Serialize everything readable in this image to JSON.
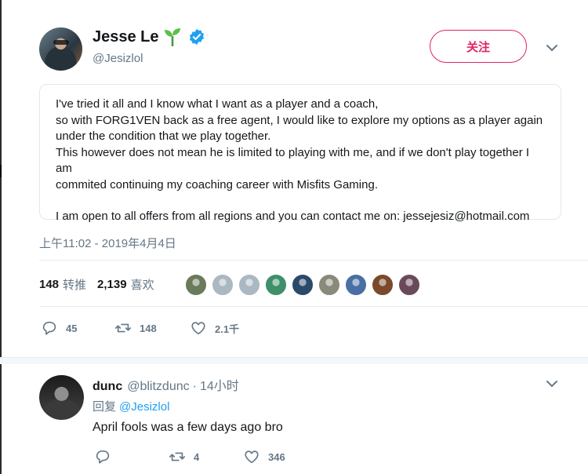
{
  "tweet": {
    "author_name": "Jesse Le",
    "author_handle": "@Jesizlol",
    "follow_label": "关注",
    "body_lines": [
      "I've tried it all and I know what I want as a player and a coach,",
      "so with FORG1VEN back as a free agent, I would like to explore my options as a player again",
      "under the condition that we play together.",
      "This however does not mean he is limited to playing with me, and if we don't play together I am",
      "commited continuing my coaching career with Misfits Gaming."
    ],
    "body_last": "I am open to all offers from all regions and you can contact me on: jessejesiz@hotmail.com",
    "timestamp": "上午11:02 - 2019年4月4日",
    "retweet_count": "148",
    "retweet_label": "转推",
    "like_count": "2,139",
    "like_label": "喜欢",
    "actions": {
      "reply": "45",
      "retweet": "148",
      "like": "2.1千"
    }
  },
  "likers": [
    {
      "name": "liker-1",
      "color": "#6a7a5a"
    },
    {
      "name": "liker-2",
      "color": "#aab8c2"
    },
    {
      "name": "liker-3",
      "color": "#aab8c2"
    },
    {
      "name": "liker-4",
      "color": "#3f8f6a"
    },
    {
      "name": "liker-5",
      "color": "#2a4a6a"
    },
    {
      "name": "liker-6",
      "color": "#8a8a7a"
    },
    {
      "name": "liker-7",
      "color": "#4a6fa5"
    },
    {
      "name": "liker-8",
      "color": "#7a4a2a"
    },
    {
      "name": "liker-9",
      "color": "#6a4a5a"
    }
  ],
  "reply": {
    "name": "dunc",
    "handle": "@blitzdunc",
    "dot": "·",
    "time": "14小时",
    "reply_prefix": "回复",
    "reply_mention": "@Jesizlol",
    "text": "April fools was a few days ago bro",
    "actions": {
      "reply": "",
      "retweet": "4",
      "like": "346"
    }
  },
  "colors": {
    "accent": "#e0245e",
    "link": "#1da1f2",
    "muted": "#657786",
    "verified": "#1da1f2"
  }
}
